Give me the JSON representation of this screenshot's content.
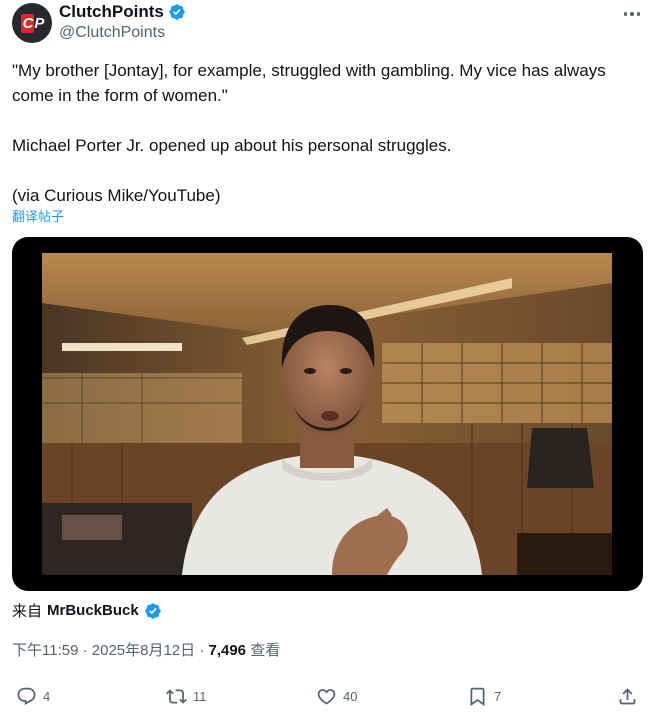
{
  "header": {
    "display_name": "ClutchPoints",
    "handle": "@ClutchPoints",
    "avatar_text_1": "C",
    "avatar_text_2": "P",
    "more_icon": "more-icon"
  },
  "tweet": {
    "text": "\"My brother [Jontay], for example, struggled with gambling. My vice has always\ncome in the form of women.\"\n\nMichael Porter Jr. opened up about his personal struggles.\n\n(via Curious Mike/YouTube)",
    "translate_label": "翻译帖子"
  },
  "media": {
    "type": "video",
    "icon": "video-thumbnail"
  },
  "source": {
    "label": "来自",
    "name": "MrBuckBuck"
  },
  "meta": {
    "time": "下午11:59 · 2025年8月12日 · ",
    "views_count": "7,496",
    "views_label": " 查看"
  },
  "actions": {
    "reply_count": "4",
    "retweet_count": "11",
    "like_count": "40",
    "bookmark_count": "7"
  },
  "colors": {
    "accent": "#1d9bf0",
    "muted": "#536471",
    "text": "#0f1419"
  }
}
